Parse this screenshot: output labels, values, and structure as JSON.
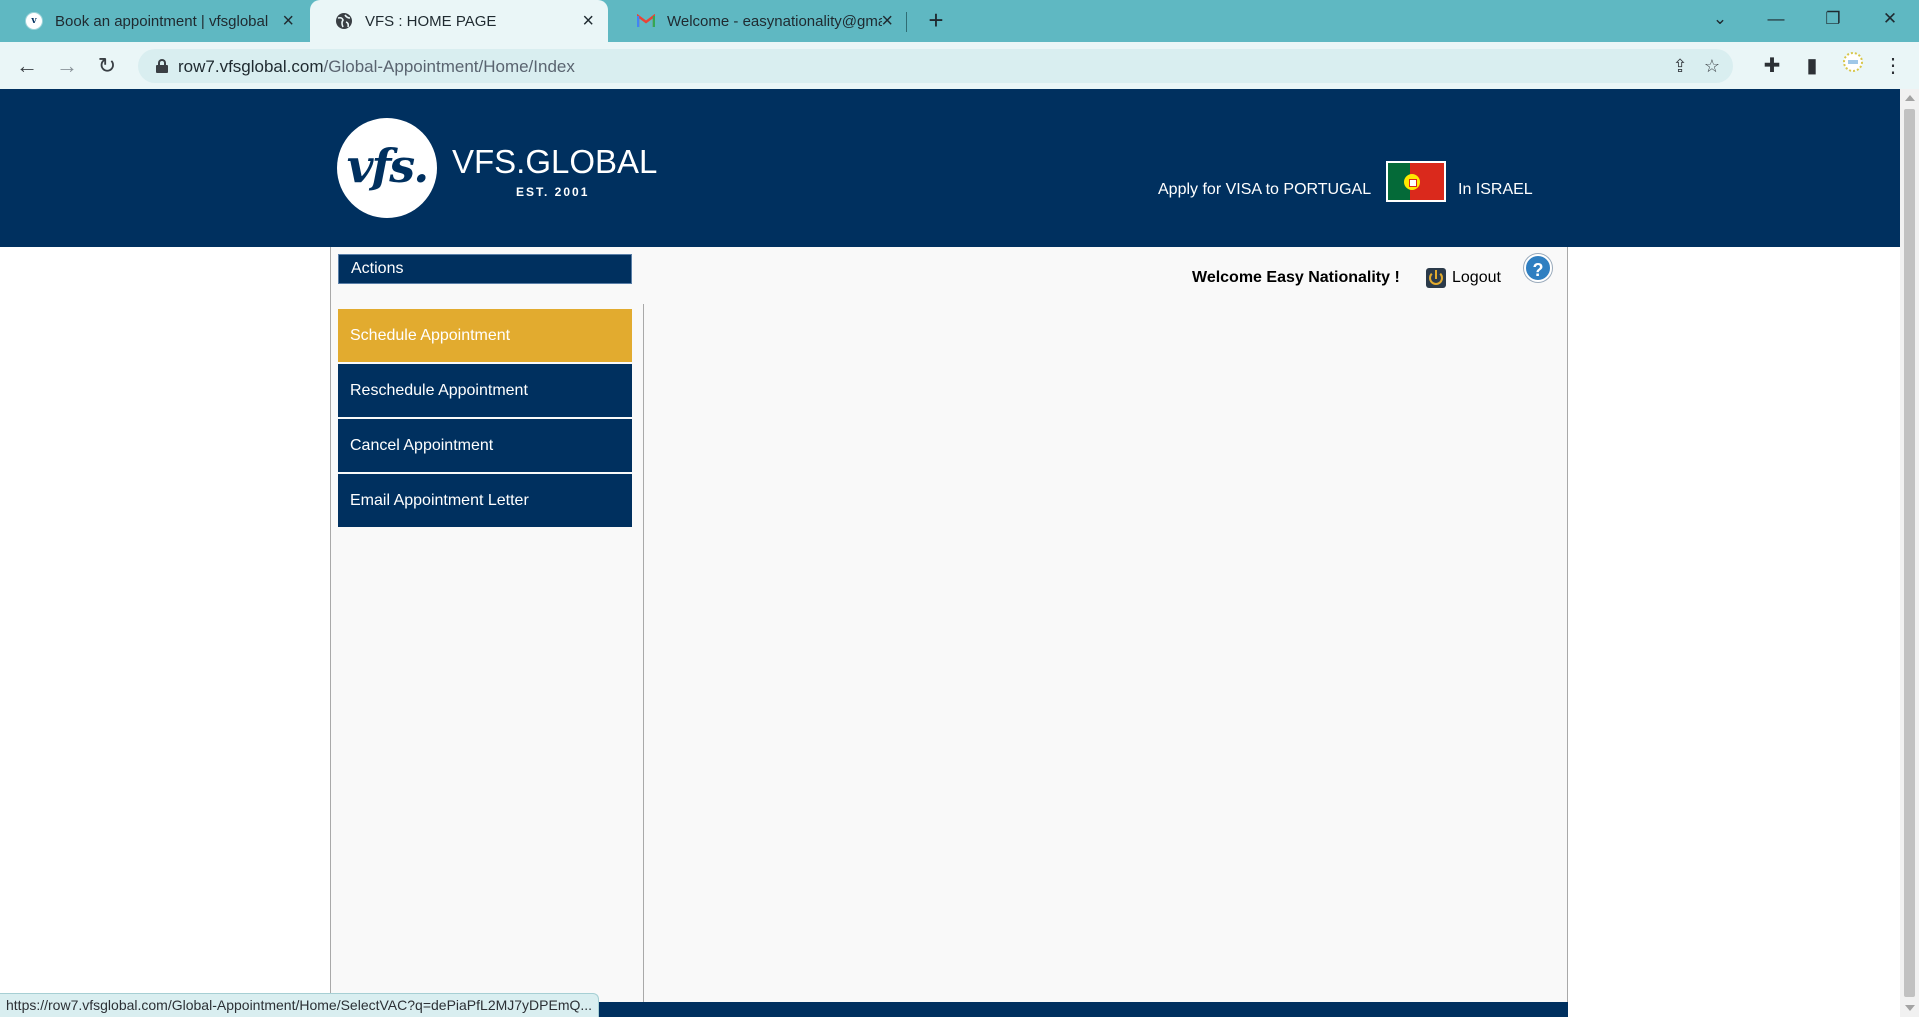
{
  "browser": {
    "tabs": [
      {
        "title": "Book an appointment | vfsglobal",
        "favicon": "vfs-favicon",
        "active": false
      },
      {
        "title": "VFS : HOME PAGE",
        "favicon": "globe-icon",
        "active": true
      },
      {
        "title": "Welcome - easynationality@gma",
        "favicon": "gmail-icon",
        "active": false
      }
    ],
    "url_host": "row7.vfsglobal.com",
    "url_path": "/Global-Appointment/Home/Index",
    "status_url": "https://row7.vfsglobal.com/Global-Appointment/Home/SelectVAC?q=dePiaPfL2MJ7yDPEmQ...",
    "icons": {
      "back": "←",
      "forward": "→",
      "reload": "↻",
      "new_tab": "+",
      "tab_close": "×",
      "share": "⇪",
      "bookmark": "☆",
      "extensions": "✚",
      "side_panel": "▮",
      "menu": "⋮",
      "minimize": "—",
      "restore": "❐",
      "window_close": "✕",
      "tab_search": "⌄"
    }
  },
  "header": {
    "logo_mark": "vfs.",
    "logo_name": "VFS.GLOBAL",
    "logo_est": "EST. 2001",
    "apply_text": "Apply for VISA to PORTUGAL",
    "country_text": "In ISRAEL",
    "brand_color": "#00305f"
  },
  "sidebar": {
    "title": "Actions",
    "items": [
      {
        "label": "Schedule Appointment",
        "active": true
      },
      {
        "label": "Reschedule Appointment",
        "active": false
      },
      {
        "label": "Cancel Appointment",
        "active": false
      },
      {
        "label": "Email Appointment Letter",
        "active": false
      }
    ],
    "active_color": "#e2ab2f"
  },
  "user": {
    "welcome": "Welcome Easy Nationality !",
    "logout": "Logout",
    "help": "?"
  }
}
